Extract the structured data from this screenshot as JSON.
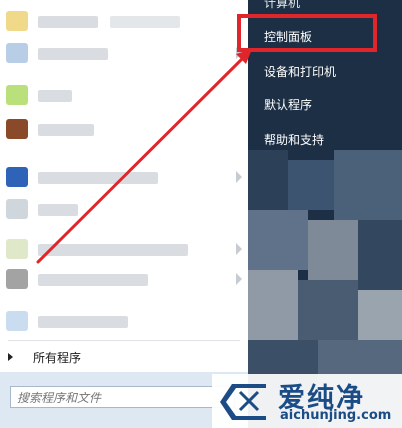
{
  "start_menu": {
    "right_menu": {
      "top_partial": "计算机",
      "items": [
        "控制面板",
        "设备和打印机",
        "默认程序",
        "帮助和支持"
      ]
    },
    "all_programs_label": "所有程序",
    "search": {
      "placeholder": "搜索程序和文件"
    }
  },
  "watermark": {
    "title": "爱纯净",
    "url": "aichunjing.com"
  },
  "colors": {
    "highlight": "#e1262b",
    "right_panel": "#1d2f44",
    "watermark": "#1b4c86"
  }
}
